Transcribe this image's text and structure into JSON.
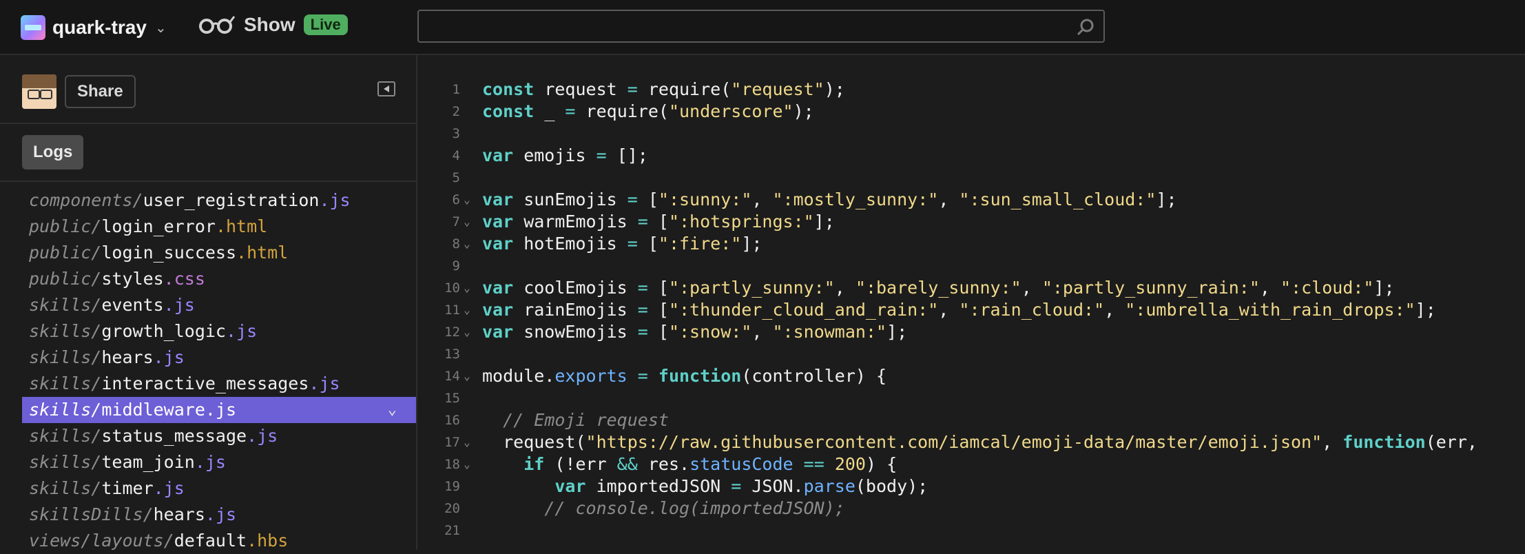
{
  "header": {
    "project_name": "quark-tray",
    "show_label": "Show",
    "live_badge": "Live",
    "search": {
      "value": "",
      "placeholder": ""
    }
  },
  "sidebar": {
    "share_label": "Share",
    "logs_label": "Logs",
    "files": [
      {
        "dir": "components/",
        "base": "user_registration",
        "ext": ".js"
      },
      {
        "dir": "public/",
        "base": "login_error",
        "ext": ".html"
      },
      {
        "dir": "public/",
        "base": "login_success",
        "ext": ".html"
      },
      {
        "dir": "public/",
        "base": "styles",
        "ext": ".css"
      },
      {
        "dir": "skills/",
        "base": "events",
        "ext": ".js"
      },
      {
        "dir": "skills/",
        "base": "growth_logic",
        "ext": ".js"
      },
      {
        "dir": "skills/",
        "base": "hears",
        "ext": ".js"
      },
      {
        "dir": "skills/",
        "base": "interactive_messages",
        "ext": ".js"
      },
      {
        "dir": "skills/",
        "base": "middleware",
        "ext": ".js",
        "active": true
      },
      {
        "dir": "skills/",
        "base": "status_message",
        "ext": ".js"
      },
      {
        "dir": "skills/",
        "base": "team_join",
        "ext": ".js"
      },
      {
        "dir": "skills/",
        "base": "timer",
        "ext": ".js"
      },
      {
        "dir": "skillsDills/",
        "base": "hears",
        "ext": ".js"
      },
      {
        "dir": "views/layouts/",
        "base": "default",
        "ext": ".hbs"
      }
    ]
  },
  "editor": {
    "lines": [
      {
        "n": "1",
        "fold": false,
        "tokens": [
          [
            "kw",
            "const"
          ],
          [
            "t",
            " request "
          ],
          [
            "op",
            "="
          ],
          [
            "t",
            " require("
          ],
          [
            "str",
            "\"request\""
          ],
          [
            "t",
            ");"
          ]
        ]
      },
      {
        "n": "2",
        "fold": false,
        "tokens": [
          [
            "kw",
            "const"
          ],
          [
            "t",
            " _ "
          ],
          [
            "op",
            "="
          ],
          [
            "t",
            " require("
          ],
          [
            "str",
            "\"underscore\""
          ],
          [
            "t",
            ");"
          ]
        ]
      },
      {
        "n": "3",
        "fold": false,
        "tokens": []
      },
      {
        "n": "4",
        "fold": false,
        "tokens": [
          [
            "kw",
            "var"
          ],
          [
            "t",
            " emojis "
          ],
          [
            "op",
            "="
          ],
          [
            "t",
            " [];"
          ]
        ]
      },
      {
        "n": "5",
        "fold": false,
        "tokens": []
      },
      {
        "n": "6",
        "fold": true,
        "tokens": [
          [
            "kw",
            "var"
          ],
          [
            "t",
            " sunEmojis "
          ],
          [
            "op",
            "="
          ],
          [
            "t",
            " ["
          ],
          [
            "str",
            "\":sunny:\""
          ],
          [
            "t",
            ", "
          ],
          [
            "str",
            "\":mostly_sunny:\""
          ],
          [
            "t",
            ", "
          ],
          [
            "str",
            "\":sun_small_cloud:\""
          ],
          [
            "t",
            "];"
          ]
        ]
      },
      {
        "n": "7",
        "fold": true,
        "tokens": [
          [
            "kw",
            "var"
          ],
          [
            "t",
            " warmEmojis "
          ],
          [
            "op",
            "="
          ],
          [
            "t",
            " ["
          ],
          [
            "str",
            "\":hotsprings:\""
          ],
          [
            "t",
            "];"
          ]
        ]
      },
      {
        "n": "8",
        "fold": true,
        "tokens": [
          [
            "kw",
            "var"
          ],
          [
            "t",
            " hotEmojis "
          ],
          [
            "op",
            "="
          ],
          [
            "t",
            " ["
          ],
          [
            "str",
            "\":fire:\""
          ],
          [
            "t",
            "];"
          ]
        ]
      },
      {
        "n": "9",
        "fold": false,
        "tokens": []
      },
      {
        "n": "10",
        "fold": true,
        "tokens": [
          [
            "kw",
            "var"
          ],
          [
            "t",
            " coolEmojis "
          ],
          [
            "op",
            "="
          ],
          [
            "t",
            " ["
          ],
          [
            "str",
            "\":partly_sunny:\""
          ],
          [
            "t",
            ", "
          ],
          [
            "str",
            "\":barely_sunny:\""
          ],
          [
            "t",
            ", "
          ],
          [
            "str",
            "\":partly_sunny_rain:\""
          ],
          [
            "t",
            ", "
          ],
          [
            "str",
            "\":cloud:\""
          ],
          [
            "t",
            "];"
          ]
        ]
      },
      {
        "n": "11",
        "fold": true,
        "tokens": [
          [
            "kw",
            "var"
          ],
          [
            "t",
            " rainEmojis "
          ],
          [
            "op",
            "="
          ],
          [
            "t",
            " ["
          ],
          [
            "str",
            "\":thunder_cloud_and_rain:\""
          ],
          [
            "t",
            ", "
          ],
          [
            "str",
            "\":rain_cloud:\""
          ],
          [
            "t",
            ", "
          ],
          [
            "str",
            "\":umbrella_with_rain_drops:\""
          ],
          [
            "t",
            "];"
          ]
        ]
      },
      {
        "n": "12",
        "fold": true,
        "tokens": [
          [
            "kw",
            "var"
          ],
          [
            "t",
            " snowEmojis "
          ],
          [
            "op",
            "="
          ],
          [
            "t",
            " ["
          ],
          [
            "str",
            "\":snow:\""
          ],
          [
            "t",
            ", "
          ],
          [
            "str",
            "\":snowman:\""
          ],
          [
            "t",
            "];"
          ]
        ]
      },
      {
        "n": "13",
        "fold": false,
        "tokens": []
      },
      {
        "n": "14",
        "fold": true,
        "tokens": [
          [
            "t",
            "module."
          ],
          [
            "prop",
            "exports"
          ],
          [
            "t",
            " "
          ],
          [
            "op",
            "="
          ],
          [
            "t",
            " "
          ],
          [
            "kw",
            "function"
          ],
          [
            "t",
            "(controller) {"
          ]
        ]
      },
      {
        "n": "15",
        "fold": false,
        "tokens": []
      },
      {
        "n": "16",
        "fold": false,
        "tokens": [
          [
            "t",
            "  "
          ],
          [
            "cm",
            "// Emoji request"
          ]
        ]
      },
      {
        "n": "17",
        "fold": true,
        "tokens": [
          [
            "t",
            "  request("
          ],
          [
            "str",
            "\"https://raw.githubusercontent.com/iamcal/emoji-data/master/emoji.json\""
          ],
          [
            "t",
            ", "
          ],
          [
            "kw",
            "function"
          ],
          [
            "t",
            "(err,"
          ]
        ]
      },
      {
        "n": "18",
        "fold": true,
        "tokens": [
          [
            "t",
            "    "
          ],
          [
            "kw",
            "if"
          ],
          [
            "t",
            " (!err "
          ],
          [
            "op",
            "&&"
          ],
          [
            "t",
            " res."
          ],
          [
            "prop",
            "statusCode"
          ],
          [
            "t",
            " "
          ],
          [
            "op",
            "=="
          ],
          [
            "t",
            " "
          ],
          [
            "num",
            "200"
          ],
          [
            "t",
            ") {"
          ]
        ]
      },
      {
        "n": "19",
        "fold": false,
        "tokens": [
          [
            "t",
            "       "
          ],
          [
            "kw",
            "var"
          ],
          [
            "t",
            " importedJSON "
          ],
          [
            "op",
            "="
          ],
          [
            "t",
            " JSON."
          ],
          [
            "prop",
            "parse"
          ],
          [
            "t",
            "(body);"
          ]
        ]
      },
      {
        "n": "20",
        "fold": false,
        "tokens": [
          [
            "t",
            "      "
          ],
          [
            "cm",
            "// console.log(importedJSON);"
          ]
        ]
      },
      {
        "n": "21",
        "fold": false,
        "tokens": []
      }
    ]
  }
}
